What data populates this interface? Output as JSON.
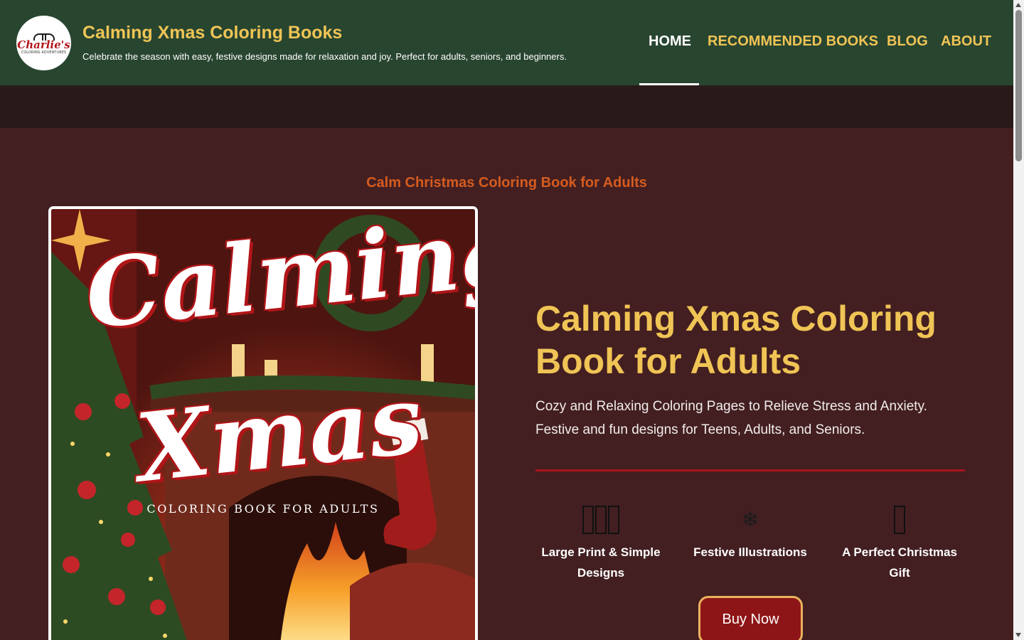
{
  "header": {
    "logo_word": "Charlie's",
    "logo_sub": "COLORING ADVENTURES",
    "site_title": "Calming Xmas Coloring Books",
    "tagline": "Celebrate the season with easy, festive designs made for relaxation and joy. Perfect for adults, seniors, and beginners."
  },
  "nav": {
    "items": [
      {
        "label": "HOME",
        "active": true
      },
      {
        "label": "RECOMMENDED BOOKS"
      },
      {
        "label": "BLOG"
      },
      {
        "label": "ABOUT"
      }
    ]
  },
  "main": {
    "section_label": "Calm Christmas Coloring Book for Adults",
    "cover": {
      "title_line1": "Calming",
      "title_line2": "Xmas",
      "subtitle": "COLORING BOOK FOR ADULTS"
    },
    "product_title": "Calming Xmas Coloring Book for Adults",
    "description_line1": "Cozy and Relaxing Coloring Pages to Relieve Stress and Anxiety.",
    "description_line2": "Festive and fun designs for Teens, Adults, and Seniors.",
    "features": [
      {
        "icon": "missing-glyph-icon",
        "label_line1": "Large Print & Simple",
        "label_line2": "Designs"
      },
      {
        "icon": "snowflake-icon",
        "glyph": "❄",
        "label_line1": "Festive Illustrations",
        "label_line2": ""
      },
      {
        "icon": "missing-glyph-icon",
        "label_line1": "A Perfect Christmas",
        "label_line2": "Gift"
      }
    ],
    "buy_button": "Buy Now"
  },
  "colors": {
    "header_bg": "#284530",
    "accent_gold": "#f0c455",
    "page_bg": "#431f21",
    "label_orange": "#d55b1f",
    "button_red": "#8e1517"
  }
}
